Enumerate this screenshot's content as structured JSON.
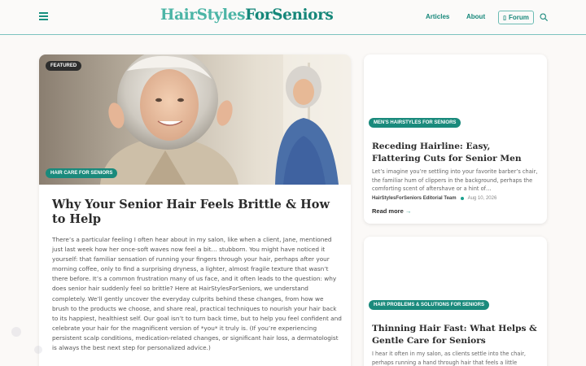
{
  "header": {
    "logo_part1": "HairStyles",
    "logo_part2": "ForSeniors",
    "nav": [
      "Articles",
      "About"
    ],
    "forum_label": "Forum",
    "icons": {
      "menu": "hamburger-icon",
      "search": "search-icon",
      "forum": "chat-icon"
    }
  },
  "featured": {
    "badge": "FEATURED",
    "category": "HAIR CARE FOR SENIORS",
    "title": "Why Your Senior Hair Feels Brittle & How to Help",
    "body": "There’s a particular feeling I often hear about in my salon, like when a client, Jane, mentioned just last week how her once-soft waves now feel a bit… stubborn. You might have noticed it yourself: that familiar sensation of running your fingers through your hair, perhaps after your morning coffee, only to find a surprising dryness, a lighter, almost fragile texture that wasn’t there before. It’s a common frustration many of us face, and it often leads to the question: why does senior hair suddenly feel so brittle? Here at HairStylesForSeniors, we understand completely. We’ll gently uncover the everyday culprits behind these changes, from how we brush to the products we choose, and share real, practical techniques to nourish your hair back to its happiest, healthiest self. Our goal isn’t to turn back time, but to help you feel confident and celebrate your hair for the magnificent version of *you* it truly is. (If you’re experiencing persistent scalp conditions, medication-related changes, or significant hair loss, a dermatologist is always the best next step for personalized advice.)"
  },
  "side_cards": [
    {
      "category": "MEN'S HAIRSTYLES FOR SENIORS",
      "title": "Receding Hairline: Easy, Flattering Cuts for Senior Men",
      "excerpt": "Let’s imagine you’re settling into your favorite barber’s chair, the familiar hum of clippers in the background, perhaps the comforting scent of aftershave or a hint of…",
      "author": "HairStylesForSeniors Editorial Team",
      "date": "Aug 10, 2026",
      "read_more": "Read more",
      "arrow": "→"
    },
    {
      "category": "HAIR PROBLEMS & SOLUTIONS FOR SENIORS",
      "title": "Thinning Hair Fast: What Helps & Gentle Care for Seniors",
      "excerpt": "I hear it often in my salon, as clients settle into the chair, perhaps running a hand through hair that feels a little"
    }
  ],
  "colors": {
    "brand_light": "#4cb5a6",
    "brand_dark": "#16877a",
    "badge_teal": "#1a8a7c",
    "badge_dark": "#2d2d2d",
    "page_bg": "#fbf9f7"
  }
}
